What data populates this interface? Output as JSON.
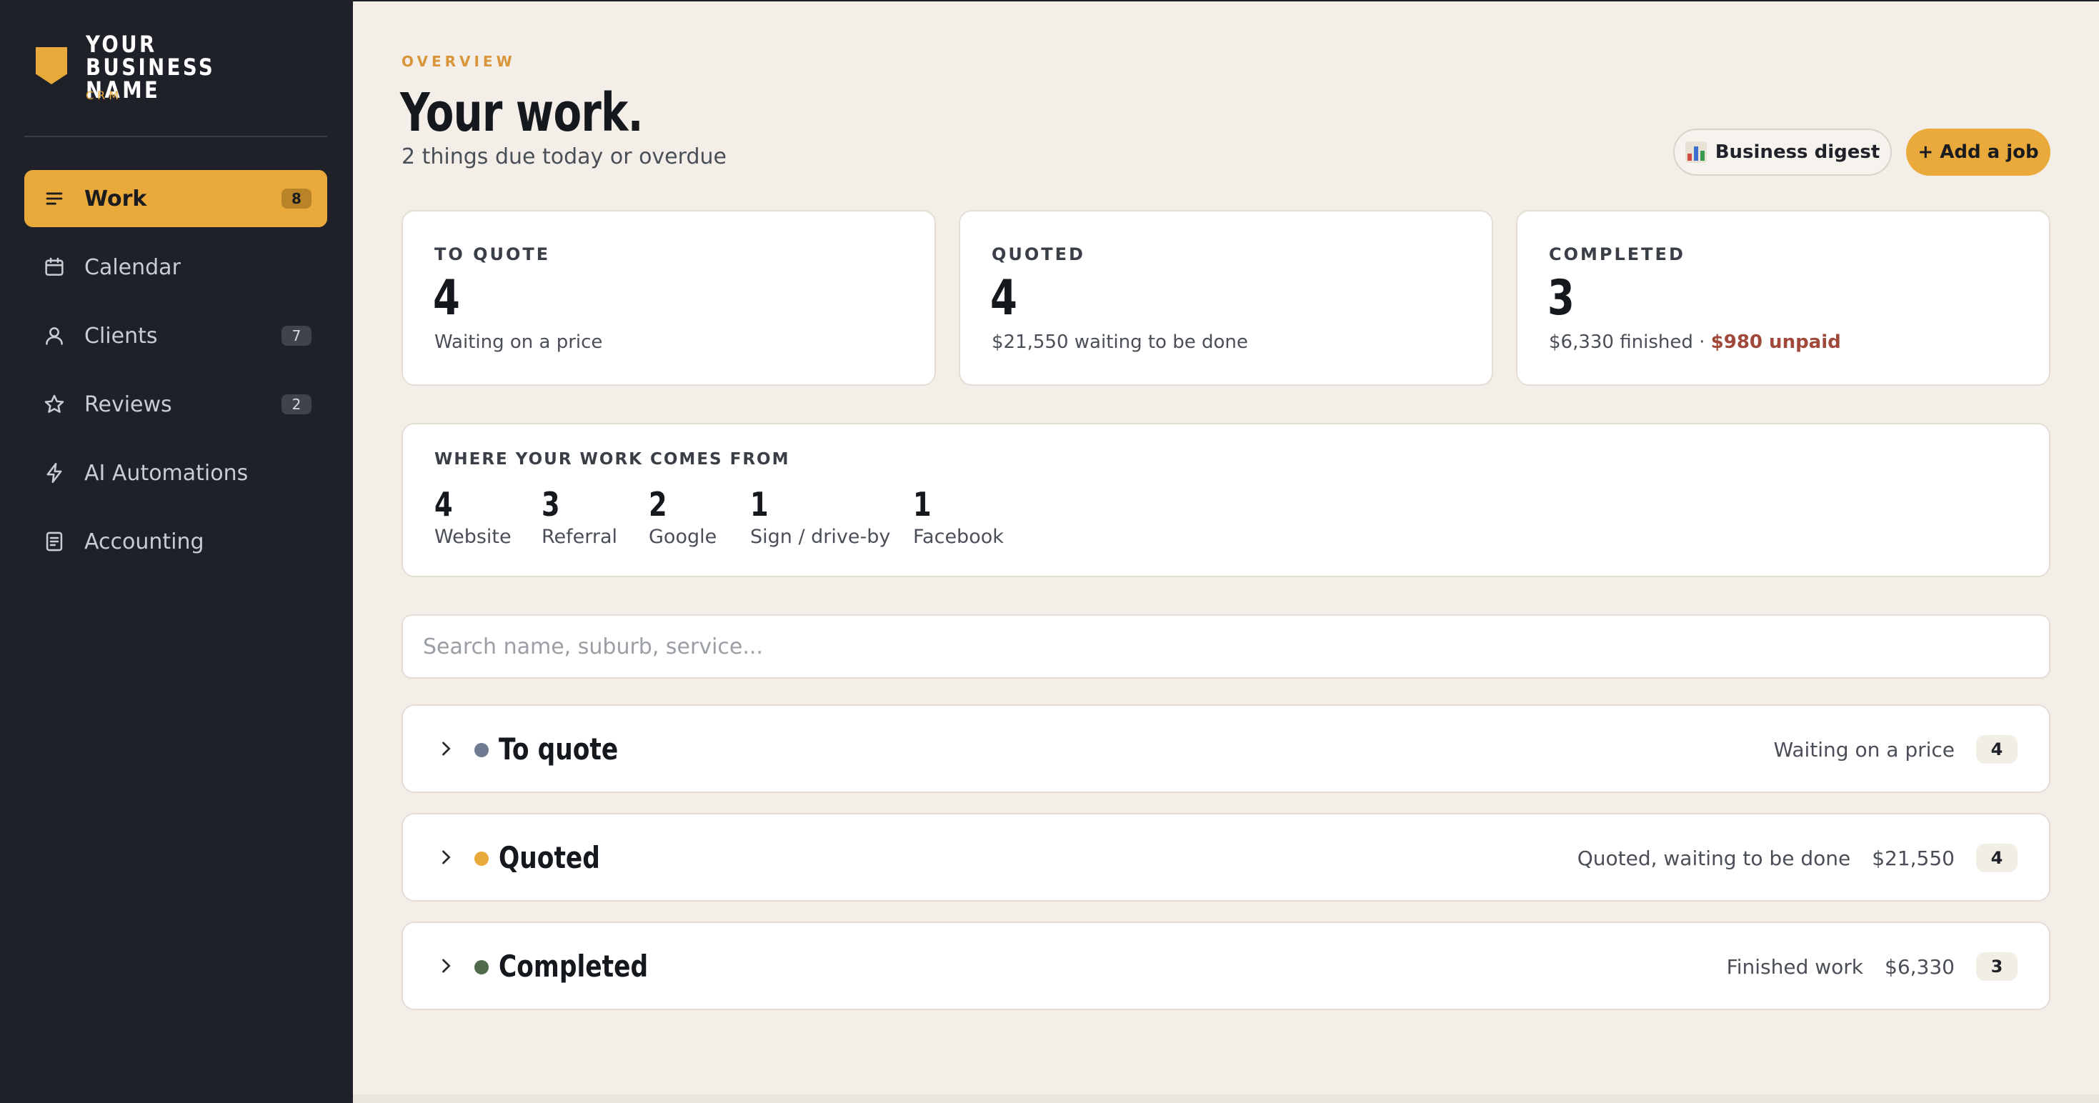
{
  "brand": {
    "name": "YOUR BUSINESS NAME",
    "tagline": "CRM",
    "accent": "#e9a93b"
  },
  "sidebar": {
    "items": [
      {
        "label": "Work",
        "icon": "list-icon",
        "badge": "8",
        "active": true
      },
      {
        "label": "Calendar",
        "icon": "calendar-icon",
        "badge": ""
      },
      {
        "label": "Clients",
        "icon": "user-icon",
        "badge": "7"
      },
      {
        "label": "Reviews",
        "icon": "star-icon",
        "badge": "2"
      },
      {
        "label": "AI Automations",
        "icon": "bolt-icon",
        "badge": ""
      },
      {
        "label": "Accounting",
        "icon": "ledger-icon",
        "badge": ""
      }
    ]
  },
  "header": {
    "eyebrow": "OVERVIEW",
    "title": "Your work.",
    "subtitle": "2 things due today or overdue",
    "digest_button": "Business digest",
    "digest_icon": "bar-chart-icon",
    "add_button": "+ Add a job"
  },
  "stats": [
    {
      "label": "TO QUOTE",
      "value": "4",
      "note": "Waiting on a price"
    },
    {
      "label": "QUOTED",
      "value": "4",
      "note": "$21,550 waiting to be done"
    },
    {
      "label": "COMPLETED",
      "value": "3",
      "note": "$6,330 finished · ",
      "note_alert": "$980 unpaid",
      "alert_color": "#a0483a"
    }
  ],
  "sources": {
    "title": "WHERE YOUR WORK COMES FROM",
    "items": [
      {
        "count": "4",
        "label": "Website"
      },
      {
        "count": "3",
        "label": "Referral"
      },
      {
        "count": "2",
        "label": "Google"
      },
      {
        "count": "1",
        "label": "Sign / drive-by"
      },
      {
        "count": "1",
        "label": "Facebook"
      }
    ]
  },
  "search": {
    "placeholder": "Search name, suburb, service...",
    "value": ""
  },
  "groups": [
    {
      "title": "To quote",
      "dot_color": "#6e7b93",
      "status": "Waiting on a price",
      "amount": "",
      "count": "4"
    },
    {
      "title": "Quoted",
      "dot_color": "#e9a93b",
      "status": "Quoted, waiting to be done",
      "amount": "$21,550",
      "count": "4"
    },
    {
      "title": "Completed",
      "dot_color": "#4f6b4a",
      "status": "Finished work",
      "amount": "$6,330",
      "count": "3"
    }
  ]
}
